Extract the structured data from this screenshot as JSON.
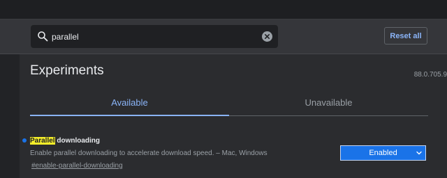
{
  "search": {
    "value": "parallel",
    "icon": "search-icon",
    "clear_icon": "clear-icon"
  },
  "toolbar": {
    "reset_label": "Reset all"
  },
  "header": {
    "title": "Experiments",
    "version": "88.0.705.9"
  },
  "tabs": [
    {
      "label": "Available",
      "selected": true
    },
    {
      "label": "Unavailable",
      "selected": false
    }
  ],
  "experiment": {
    "title_highlight": "Parallel",
    "title_rest": " downloading",
    "description": "Enable parallel downloading to accelerate download speed. – Mac, Windows",
    "link": "#enable-parallel-downloading",
    "state": "Enabled"
  },
  "colors": {
    "accent": "#8ab4f8",
    "select_bg": "#1a73e8",
    "highlight": "#f5ee2a"
  }
}
